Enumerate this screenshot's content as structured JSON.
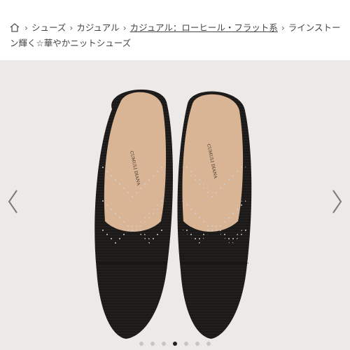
{
  "breadcrumb": {
    "home_icon": "home-icon",
    "items": [
      "シューズ",
      "カジュアル",
      "カジュアル：ローヒール・フラット系",
      "ラインストーン輝く☆華やかニットシューズ"
    ]
  },
  "product": {
    "brand_mark": "CUMULI DIANA"
  },
  "gallery": {
    "dot_count": 7,
    "active_index": 3
  },
  "colors": {
    "background": "#eceae8",
    "shoe": "#1b1918",
    "lining": "#d9b596",
    "active_dot": "#222222"
  }
}
